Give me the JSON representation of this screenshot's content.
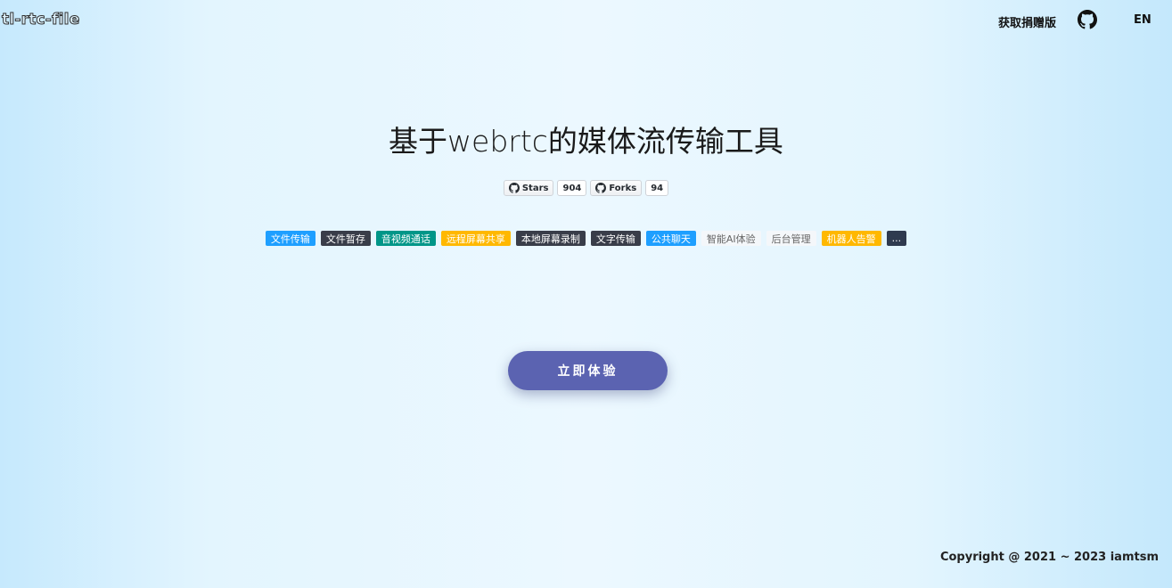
{
  "header": {
    "logo": "tl-rtc-file",
    "donate_label": "获取捐赠版",
    "lang_label": "EN",
    "github_icon": "github-icon"
  },
  "hero": {
    "title": "基于webrtc的媒体流传输工具"
  },
  "github": {
    "stars_label": "Stars",
    "stars_count": "904",
    "forks_label": "Forks",
    "forks_count": "94"
  },
  "features": [
    {
      "label": "文件传输",
      "bg": "#1e9fff",
      "fg": "#ffffff"
    },
    {
      "label": "文件暂存",
      "bg": "#393d49",
      "fg": "#ffffff"
    },
    {
      "label": "音视频通话",
      "bg": "#009688",
      "fg": "#ffffff"
    },
    {
      "label": "远程屏幕共享",
      "bg": "#ffb800",
      "fg": "#ffffff"
    },
    {
      "label": "本地屏幕录制",
      "bg": "#393d49",
      "fg": "#ffffff"
    },
    {
      "label": "文字传输",
      "bg": "#393d49",
      "fg": "#ffffff"
    },
    {
      "label": "公共聊天",
      "bg": "#1e9fff",
      "fg": "#ffffff"
    },
    {
      "label": "智能AI体验",
      "bg": "#f4f7fa",
      "fg": "#666666"
    },
    {
      "label": "后台管理",
      "bg": "#f4f7fa",
      "fg": "#666666"
    },
    {
      "label": "机器人告警",
      "bg": "#ffb800",
      "fg": "#ffffff"
    },
    {
      "label": "...",
      "bg": "#2f3a4f",
      "fg": "#ffffff"
    }
  ],
  "cta": {
    "label": "立即体验",
    "color": "#5b63b1"
  },
  "footer": {
    "copyright": "Copyright @ 2021 ~ 2023 iamtsm"
  }
}
